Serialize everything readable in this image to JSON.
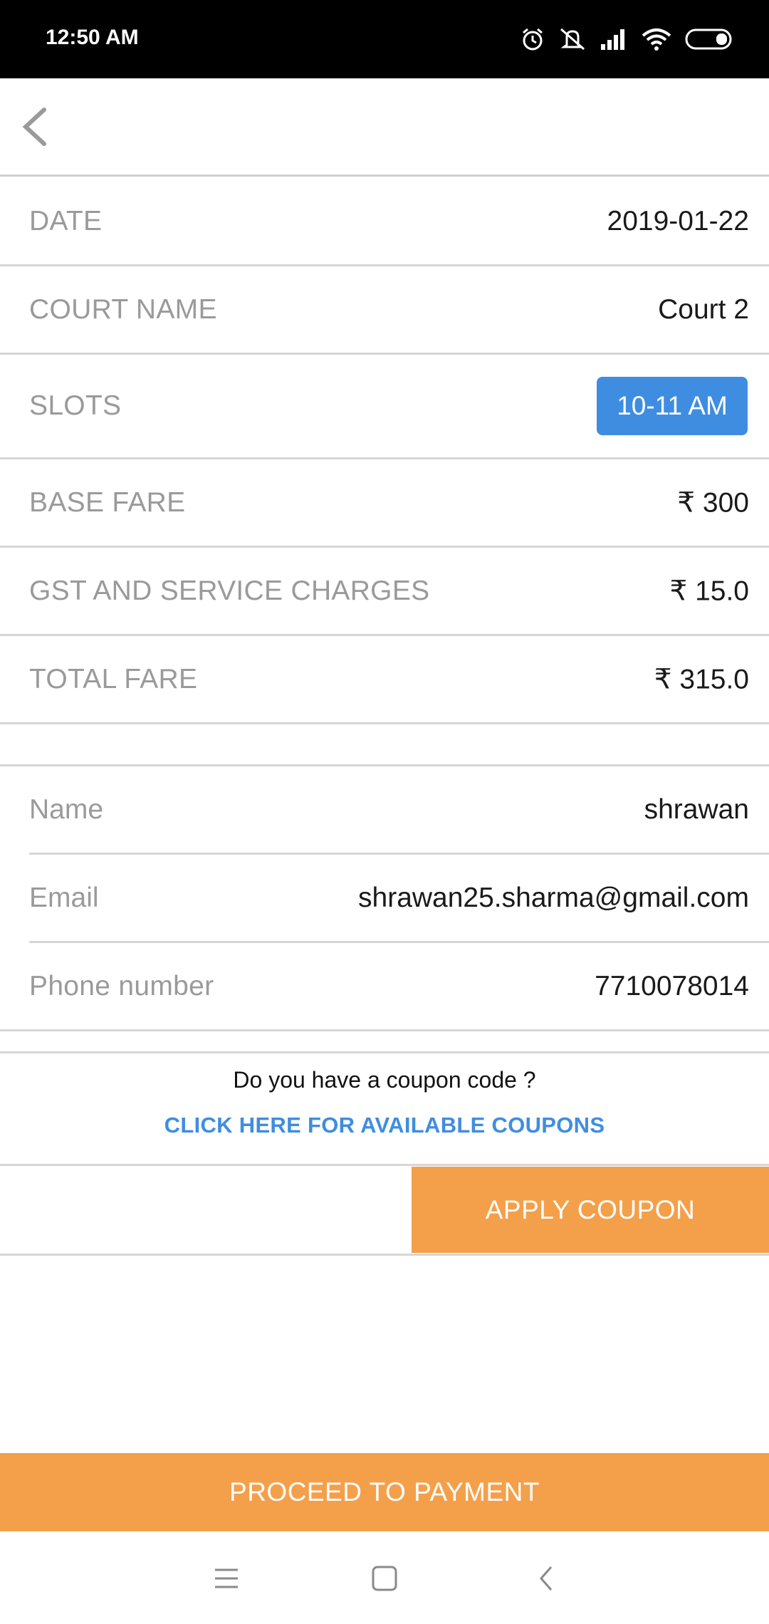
{
  "status_bar": {
    "time": "12:50 AM",
    "icons": [
      "alarm-icon",
      "mute-icon",
      "signal-icon",
      "wifi-icon",
      "battery-icon"
    ]
  },
  "app_bar": {
    "back_icon": "chevron-left-icon"
  },
  "booking": {
    "date_label": "DATE",
    "date_value": "2019-01-22",
    "court_label": "COURT NAME",
    "court_value": "Court 2",
    "slots_label": "SLOTS",
    "slot_value": "10-11 AM",
    "base_fare_label": "BASE FARE",
    "base_fare_value": "₹ 300",
    "gst_label": "GST AND SERVICE CHARGES",
    "gst_value": "₹ 15.0",
    "total_label": "TOTAL FARE",
    "total_value": "₹ 315.0"
  },
  "user": {
    "name_label": "Name",
    "name_value": "shrawan",
    "email_label": "Email",
    "email_value": "shrawan25.sharma@gmail.com",
    "phone_label": "Phone number",
    "phone_value": "7710078014"
  },
  "coupon": {
    "question": "Do you have a coupon code ?",
    "link": "CLICK HERE FOR AVAILABLE COUPONS",
    "input_value": "",
    "apply_label": "APPLY COUPON"
  },
  "footer": {
    "proceed_label": "PROCEED TO PAYMENT"
  },
  "nav_bar": {
    "icons": [
      "menu-icon",
      "home-square-icon",
      "back-chevron-icon"
    ]
  },
  "colors": {
    "accent_orange": "#f4a04a",
    "accent_blue": "#3f8de0",
    "label_gray": "#9a9a9a"
  }
}
